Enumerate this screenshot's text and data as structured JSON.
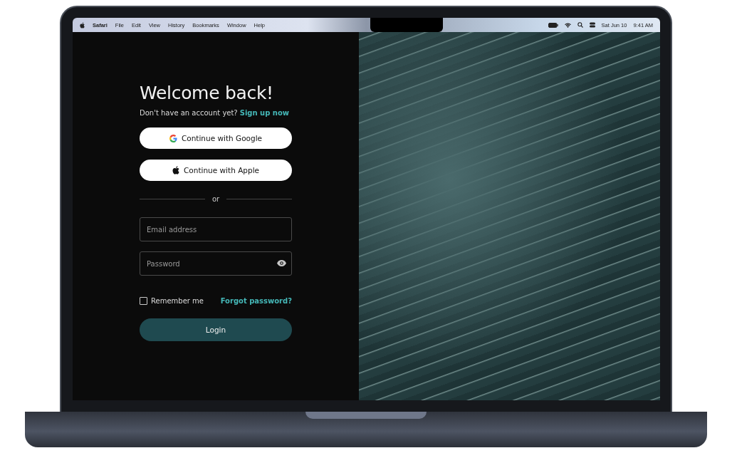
{
  "menu_bar": {
    "app_name": "Safari",
    "items": [
      "File",
      "Edit",
      "View",
      "History",
      "Bookmarks",
      "Window",
      "Help"
    ],
    "date": "Sat Jun 10",
    "time": "9:41 AM"
  },
  "login": {
    "title": "Welcome back!",
    "signup_prompt": "Don't have an account yet?",
    "signup_link": "Sign up now",
    "social_buttons": [
      {
        "kind": "google",
        "label": "Continue with Google"
      },
      {
        "kind": "apple",
        "label": "Continue with Apple"
      }
    ],
    "divider_text": "or",
    "email": {
      "placeholder": "Email address"
    },
    "password": {
      "placeholder": "Password"
    },
    "remember_me": {
      "label": "Remember me",
      "checked": false
    },
    "forgot_link": "Forgot password?",
    "submit": "Login"
  }
}
